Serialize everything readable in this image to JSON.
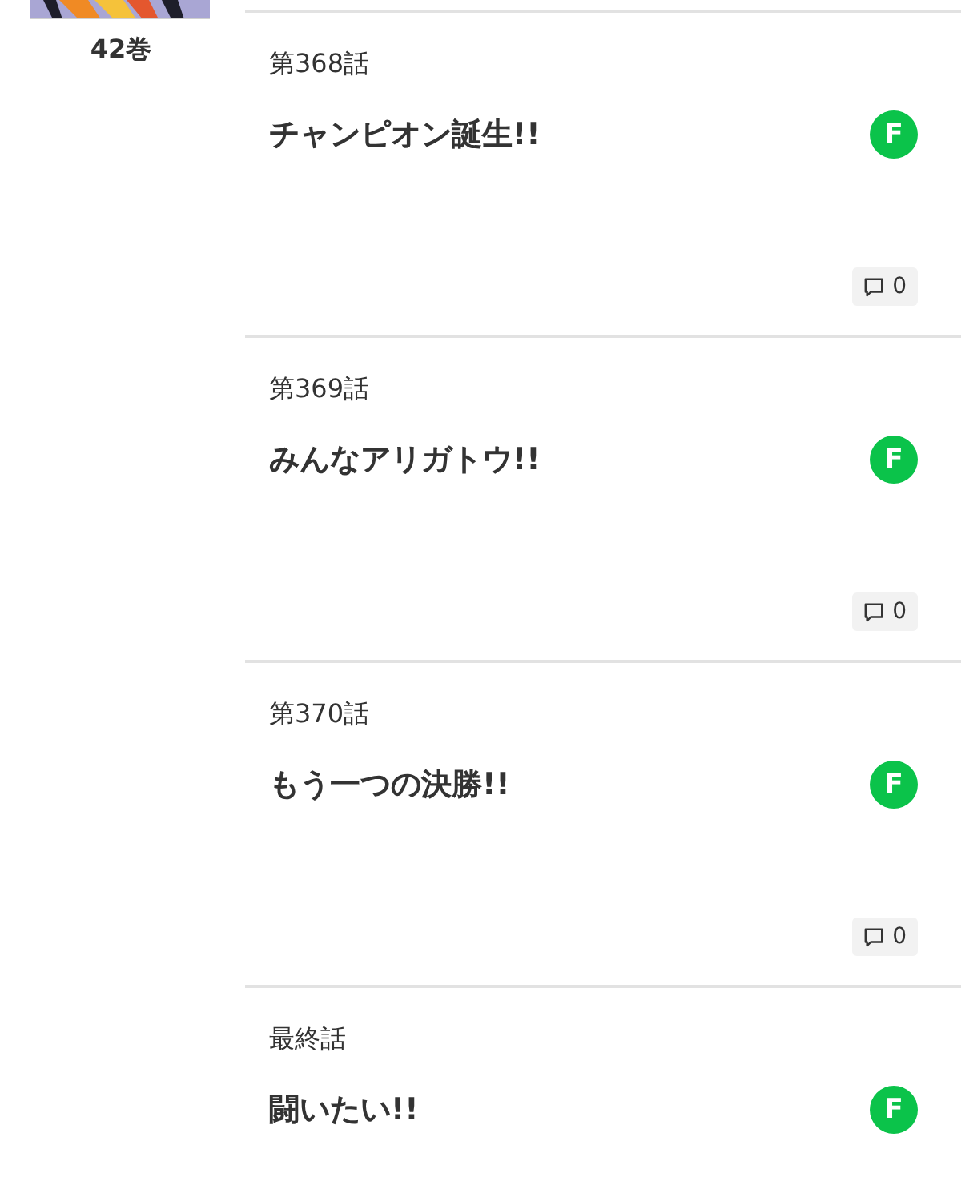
{
  "volume": {
    "label": "42巻"
  },
  "episodes": [
    {
      "number": "第368話",
      "title": "チャンピオン誕生!!",
      "badge": "F",
      "comments": "0"
    },
    {
      "number": "第369話",
      "title": "みんなアリガトウ!!",
      "badge": "F",
      "comments": "0"
    },
    {
      "number": "第370話",
      "title": "もう一つの決勝!!",
      "badge": "F",
      "comments": "0"
    },
    {
      "number": "最終話",
      "title": "闘いたい!!",
      "badge": "F"
    }
  ]
}
